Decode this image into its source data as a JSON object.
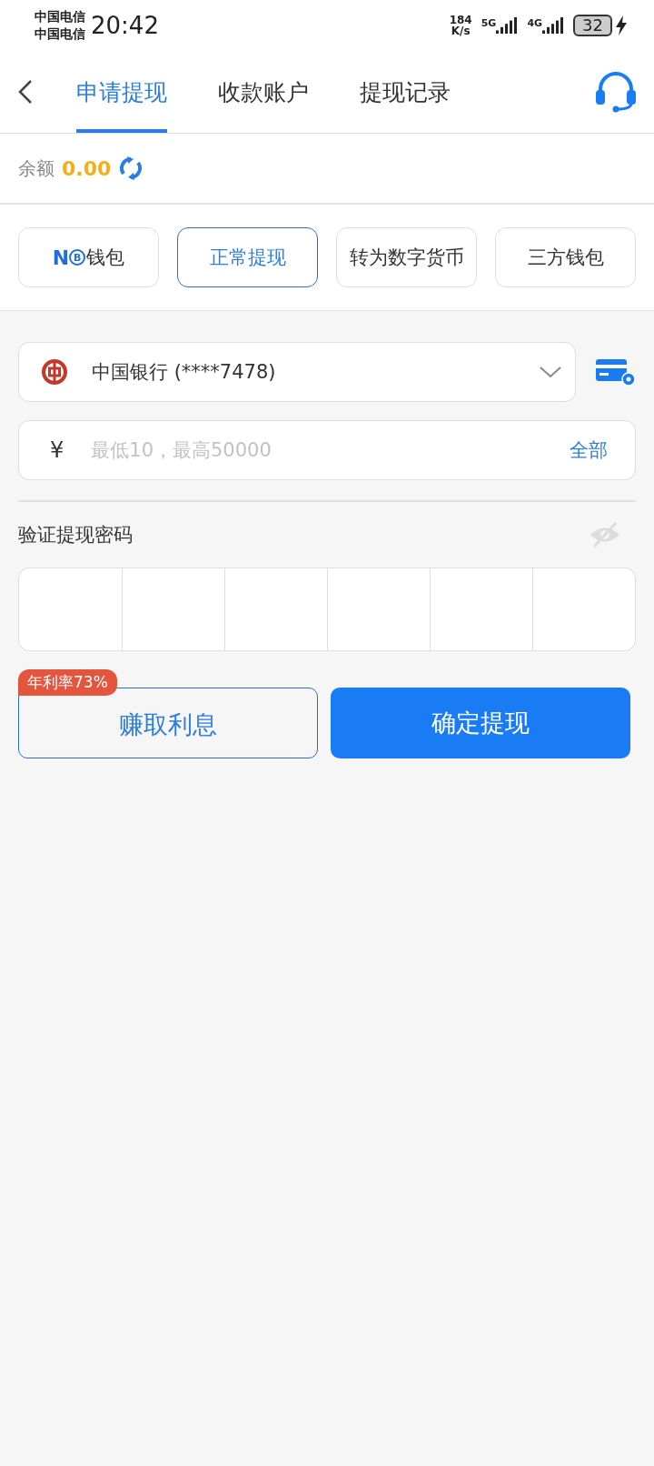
{
  "status_bar": {
    "carriers": [
      "中国电信",
      "中国电信"
    ],
    "time": "20:42",
    "net_speed": [
      "184",
      "K/s"
    ],
    "networks": [
      "5G",
      "4G"
    ],
    "battery": "32",
    "charging": true
  },
  "tabs": [
    {
      "label": "申请提现",
      "selected": true
    },
    {
      "label": "收款账户",
      "selected": false
    },
    {
      "label": "提现记录",
      "selected": false
    }
  ],
  "balance": {
    "label": "余额",
    "amount": "0.00"
  },
  "options": [
    {
      "label": "钱包",
      "logo": [
        "N",
        "B"
      ],
      "selected": false
    },
    {
      "label": "正常提现",
      "selected": true
    },
    {
      "label": "转为数字货币",
      "selected": false
    },
    {
      "label": "三方钱包",
      "selected": false
    }
  ],
  "bank_select": {
    "value": "中国银行 (****7478)"
  },
  "amount_field": {
    "currency": "¥",
    "placeholder": "最低10，最高50000",
    "all_link": "全部"
  },
  "password": {
    "label": "验证提现密码"
  },
  "buttons": {
    "earn": {
      "label": "赚取利息",
      "badge": "年利率73%"
    },
    "confirm": {
      "label": "确定提现"
    }
  }
}
